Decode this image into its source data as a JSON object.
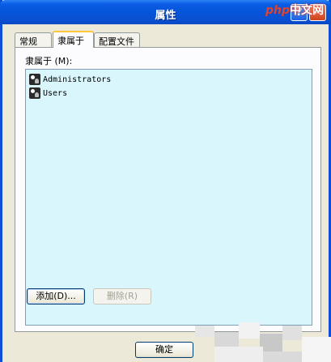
{
  "window": {
    "title": "属性",
    "help_glyph": "?",
    "close_glyph": "✕"
  },
  "watermark": {
    "brand": "php",
    "text": "中文网"
  },
  "tabs": [
    {
      "label": "常规",
      "active": false
    },
    {
      "label": "隶属于",
      "active": true
    },
    {
      "label": "配置文件",
      "active": false
    }
  ],
  "memberof": {
    "label": "隶属于 (M):",
    "items": [
      {
        "name": "Administrators",
        "icon": "group-icon"
      },
      {
        "name": "Users",
        "icon": "group-icon"
      }
    ]
  },
  "buttons": {
    "add": "添加(D)...",
    "remove": "删除(R)",
    "ok": "确定"
  },
  "colors": {
    "titlebar": "#0654d9",
    "dialog_bg": "#ece9d8",
    "listbox_bg": "#d9f6fc",
    "active_tab_highlight": "#ffc83c"
  }
}
